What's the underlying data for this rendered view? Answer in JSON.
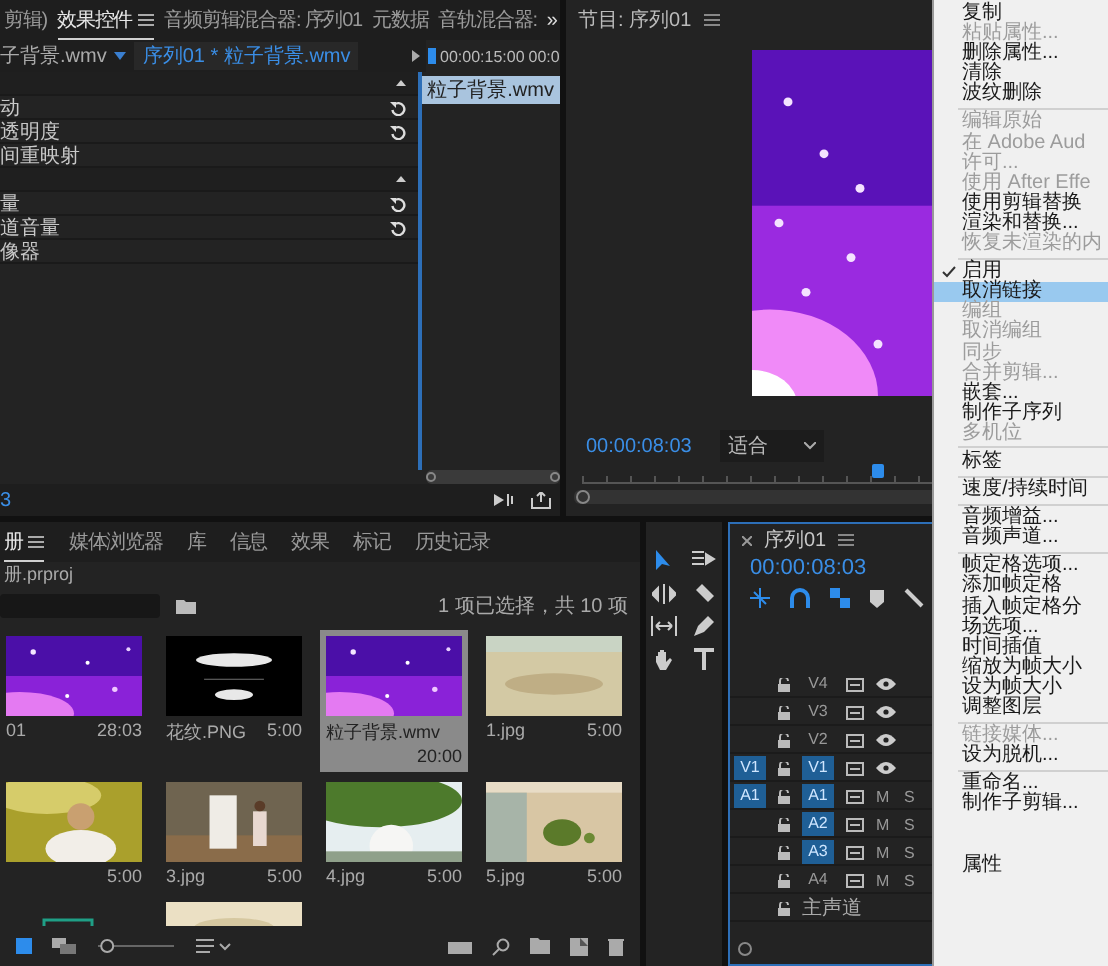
{
  "effect_controls": {
    "tabs": [
      {
        "label": "剪辑)",
        "selected": false
      },
      {
        "label": "效果控件",
        "selected": true
      },
      {
        "label": "音频剪辑混合器: 序列01",
        "selected": false
      },
      {
        "label": "元数据",
        "selected": false
      },
      {
        "label": "音轨混合器:",
        "selected": false
      }
    ],
    "more": "»",
    "source_clip": "子背景.wmv",
    "sequence_clip": "序列01 * 粒子背景.wmv",
    "ruler_time": "00:00:15:00",
    "ruler_time_2": "00:0",
    "clip_label": "粒子背景.wmv",
    "rows": [
      {
        "kind": "header"
      },
      {
        "kind": "effect",
        "label": "动",
        "reset": true
      },
      {
        "kind": "effect",
        "label": "透明度",
        "reset": true
      },
      {
        "kind": "effect",
        "label": "间重映射",
        "reset": false
      },
      {
        "kind": "header"
      },
      {
        "kind": "effect",
        "label": "量",
        "reset": true
      },
      {
        "kind": "effect",
        "label": "道音量",
        "reset": true
      },
      {
        "kind": "effect",
        "label": "像器",
        "reset": false
      }
    ],
    "timecode": "3"
  },
  "program": {
    "title": "节目: 序列01",
    "timecode": "00:00:08:03",
    "fit": "适合"
  },
  "context_menu": {
    "items": [
      {
        "kind": "item",
        "label": "复制",
        "disabled": false,
        "checked": false,
        "selected": false
      },
      {
        "kind": "item",
        "label": "粘贴属性...",
        "disabled": true,
        "checked": false,
        "selected": false
      },
      {
        "kind": "item",
        "label": "删除属性...",
        "disabled": false,
        "checked": false,
        "selected": false
      },
      {
        "kind": "item",
        "label": "清除",
        "disabled": false,
        "checked": false,
        "selected": false
      },
      {
        "kind": "item",
        "label": "波纹删除",
        "disabled": false,
        "checked": false,
        "selected": false
      },
      {
        "kind": "separator"
      },
      {
        "kind": "item",
        "label": "编辑原始",
        "disabled": true,
        "checked": false,
        "selected": false
      },
      {
        "kind": "item",
        "label": "在 Adobe Aud",
        "disabled": true,
        "checked": false,
        "selected": false
      },
      {
        "kind": "item",
        "label": "许可...",
        "disabled": true,
        "checked": false,
        "selected": false
      },
      {
        "kind": "item",
        "label": "使用 After Effe",
        "disabled": true,
        "checked": false,
        "selected": false
      },
      {
        "kind": "item",
        "label": "使用剪辑替换",
        "disabled": false,
        "checked": false,
        "selected": false
      },
      {
        "kind": "item",
        "label": "渲染和替换...",
        "disabled": false,
        "checked": false,
        "selected": false
      },
      {
        "kind": "item",
        "label": "恢复未渲染的内",
        "disabled": true,
        "checked": false,
        "selected": false
      },
      {
        "kind": "separator"
      },
      {
        "kind": "item",
        "label": "启用",
        "disabled": false,
        "checked": true,
        "selected": false
      },
      {
        "kind": "item",
        "label": "取消链接",
        "disabled": false,
        "checked": false,
        "selected": true
      },
      {
        "kind": "item",
        "label": "编组",
        "disabled": true,
        "checked": false,
        "selected": false
      },
      {
        "kind": "item",
        "label": "取消编组",
        "disabled": true,
        "checked": false,
        "selected": false
      },
      {
        "kind": "item",
        "label": "同步",
        "disabled": true,
        "checked": false,
        "selected": false
      },
      {
        "kind": "item",
        "label": "合并剪辑...",
        "disabled": true,
        "checked": false,
        "selected": false
      },
      {
        "kind": "item",
        "label": "嵌套...",
        "disabled": false,
        "checked": false,
        "selected": false
      },
      {
        "kind": "item",
        "label": "制作子序列",
        "disabled": false,
        "checked": false,
        "selected": false
      },
      {
        "kind": "item",
        "label": "多机位",
        "disabled": true,
        "checked": false,
        "selected": false
      },
      {
        "kind": "separator"
      },
      {
        "kind": "item",
        "label": "标签",
        "disabled": false,
        "checked": false,
        "selected": false
      },
      {
        "kind": "separator"
      },
      {
        "kind": "item",
        "label": "速度/持续时间",
        "disabled": false,
        "checked": false,
        "selected": false
      },
      {
        "kind": "separator"
      },
      {
        "kind": "item",
        "label": "音频增益...",
        "disabled": false,
        "checked": false,
        "selected": false
      },
      {
        "kind": "item",
        "label": "音频声道...",
        "disabled": false,
        "checked": false,
        "selected": false
      },
      {
        "kind": "separator"
      },
      {
        "kind": "item",
        "label": "帧定格选项...",
        "disabled": false,
        "checked": false,
        "selected": false
      },
      {
        "kind": "item",
        "label": "添加帧定格",
        "disabled": false,
        "checked": false,
        "selected": false
      },
      {
        "kind": "item",
        "label": "插入帧定格分",
        "disabled": false,
        "checked": false,
        "selected": false
      },
      {
        "kind": "item",
        "label": "场选项...",
        "disabled": false,
        "checked": false,
        "selected": false
      },
      {
        "kind": "item",
        "label": "时间插值",
        "disabled": false,
        "checked": false,
        "selected": false
      },
      {
        "kind": "item",
        "label": "缩放为帧大小",
        "disabled": false,
        "checked": false,
        "selected": false
      },
      {
        "kind": "item",
        "label": "设为帧大小",
        "disabled": false,
        "checked": false,
        "selected": false
      },
      {
        "kind": "item",
        "label": "调整图层",
        "disabled": false,
        "checked": false,
        "selected": false
      },
      {
        "kind": "separator"
      },
      {
        "kind": "item",
        "label": "链接媒体...",
        "disabled": true,
        "checked": false,
        "selected": false
      },
      {
        "kind": "item",
        "label": "设为脱机...",
        "disabled": false,
        "checked": false,
        "selected": false
      },
      {
        "kind": "separator"
      },
      {
        "kind": "item",
        "label": "重命名...",
        "disabled": false,
        "checked": false,
        "selected": false
      },
      {
        "kind": "item",
        "label": "制作子剪辑...",
        "disabled": false,
        "checked": false,
        "selected": false
      },
      {
        "kind": "hidden"
      },
      {
        "kind": "item",
        "label": "属性",
        "disabled": false,
        "checked": false,
        "selected": false
      }
    ]
  },
  "project": {
    "tabs": [
      {
        "label": "册",
        "selected": true
      },
      {
        "label": "媒体浏览器",
        "selected": false
      },
      {
        "label": "库",
        "selected": false
      },
      {
        "label": "信息",
        "selected": false
      },
      {
        "label": "效果",
        "selected": false
      },
      {
        "label": "标记",
        "selected": false
      },
      {
        "label": "历史记录",
        "selected": false
      }
    ],
    "path": "册.prproj",
    "selection_count": "1 项已选择，共 10 项",
    "zoom_slider": {
      "level": 0.05
    },
    "items": [
      {
        "label": "01",
        "duration": "28:03",
        "selected": false
      },
      {
        "label": "花纹.PNG",
        "duration": "5:00",
        "selected": false
      },
      {
        "label": "粒子背景.wmv",
        "duration": "20:00",
        "selected": true
      },
      {
        "label": "1.jpg",
        "duration": "5:00",
        "selected": false
      },
      {
        "duration": "5:00",
        "selected": false
      },
      {
        "label": "3.jpg",
        "duration": "5:00",
        "selected": false
      },
      {
        "label": "4.jpg",
        "duration": "5:00",
        "selected": false
      },
      {
        "label": "5.jpg",
        "duration": "5:00",
        "selected": false
      },
      {
        "kind": "icon",
        "selected": false
      },
      {
        "selected": false
      }
    ]
  },
  "timeline": {
    "title": "序列01",
    "timecode": "00:00:08:03",
    "tracks": [
      {
        "kind": "video",
        "name": "V4",
        "targeted": false
      },
      {
        "kind": "video",
        "name": "V3",
        "targeted": false
      },
      {
        "kind": "video",
        "name": "V2",
        "targeted": false
      },
      {
        "kind": "video",
        "name": "V1",
        "source": "V1",
        "targeted": true
      },
      {
        "kind": "audio",
        "name": "A1",
        "source": "A1",
        "targeted": true,
        "mute": "M",
        "solo": "S"
      },
      {
        "kind": "audio",
        "name": "A2",
        "targeted": true,
        "mute": "M",
        "solo": "S"
      },
      {
        "kind": "audio",
        "name": "A3",
        "targeted": true,
        "mute": "M",
        "solo": "S"
      },
      {
        "kind": "audio",
        "name": "A4",
        "targeted": false,
        "mute": "M",
        "solo": "S"
      },
      {
        "kind": "master",
        "name": "主声道"
      }
    ]
  }
}
